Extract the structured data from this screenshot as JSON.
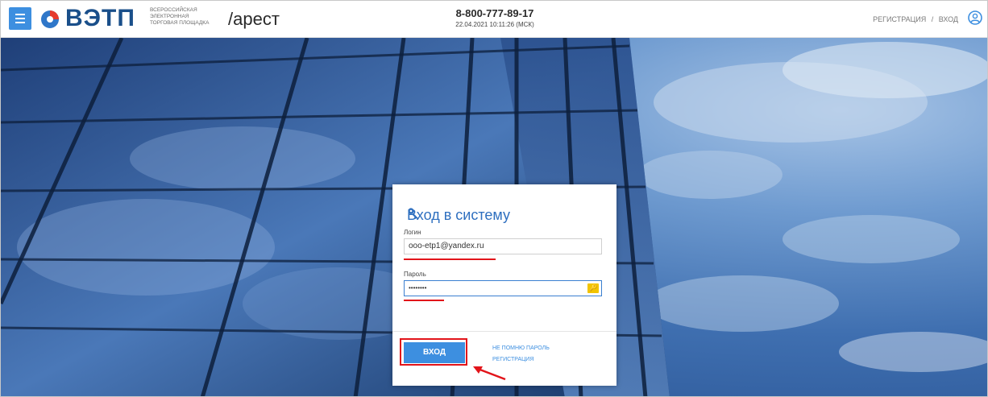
{
  "header": {
    "logo_text": "ВЭТП",
    "logo_sub": [
      "ВСЕРОССИЙСКАЯ",
      "ЭЛЕКТРОННАЯ",
      "ТОРГОВАЯ ПЛОЩАДКА"
    ],
    "section": "/арест",
    "phone": "8-800-777-89-17",
    "datetime": "22.04.2021 10:11:26 (МСК)",
    "register_link": "РЕГИСТРАЦИЯ",
    "separator": "/",
    "login_link": "ВХОД"
  },
  "login": {
    "title": "Вход в систему",
    "login_label": "Логин",
    "login_value": "ooo-etp1@yandex.ru",
    "password_label": "Пароль",
    "password_value": "••••••••",
    "submit": "ВХОД",
    "forgot_link": "НЕ ПОМНЮ ПАРОЛЬ",
    "register_link": "РЕГИСТРАЦИЯ"
  },
  "colors": {
    "accent": "#3d8fe0",
    "brand_dark": "#1a4f8a",
    "highlight_red": "#e2141a",
    "key_yellow": "#f2c400"
  },
  "icons": {
    "menu": "hamburger-icon",
    "logo": "vetp-logo-icon",
    "user": "user-circle-icon",
    "title": "key-icon",
    "password_toggle": "key-badge-icon"
  }
}
